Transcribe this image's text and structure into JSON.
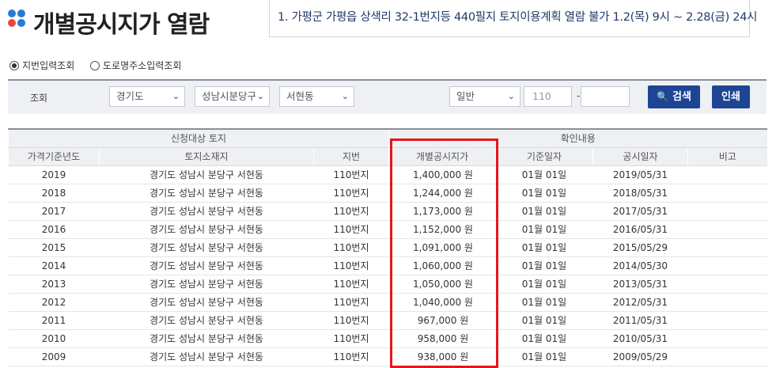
{
  "header": {
    "title": "개별공시지가 열람",
    "notice": "1. 가평군 가평읍 상색리 32-1번지등 440필지 토지이용계획 열람 불가 1.2(목) 9시 ~ 2.28(금) 24시"
  },
  "radio": {
    "option1": "지번입력조회",
    "option2": "도로명주소입력조회",
    "selected": "option1"
  },
  "search": {
    "label": "조회",
    "province": "경기도",
    "city": "성남시분당구",
    "dong": "서현동",
    "type": "일반",
    "lot_main": "110",
    "lot_sub": "",
    "search_button": "검색",
    "print_button": "인쇄"
  },
  "table": {
    "group1": "신청대상 토지",
    "group2": "확인내용",
    "columns": [
      "가격기준년도",
      "토지소재지",
      "지번",
      "개별공시지가",
      "기준일자",
      "공시일자",
      "비고"
    ],
    "rows": [
      [
        "2019",
        "경기도 성남시 분당구 서현동",
        "110번지",
        "1,400,000 원",
        "01월 01일",
        "2019/05/31",
        ""
      ],
      [
        "2018",
        "경기도 성남시 분당구 서현동",
        "110번지",
        "1,244,000 원",
        "01월 01일",
        "2018/05/31",
        ""
      ],
      [
        "2017",
        "경기도 성남시 분당구 서현동",
        "110번지",
        "1,173,000 원",
        "01월 01일",
        "2017/05/31",
        ""
      ],
      [
        "2016",
        "경기도 성남시 분당구 서현동",
        "110번지",
        "1,152,000 원",
        "01월 01일",
        "2016/05/31",
        ""
      ],
      [
        "2015",
        "경기도 성남시 분당구 서현동",
        "110번지",
        "1,091,000 원",
        "01월 01일",
        "2015/05/29",
        ""
      ],
      [
        "2014",
        "경기도 성남시 분당구 서현동",
        "110번지",
        "1,060,000 원",
        "01월 01일",
        "2014/05/30",
        ""
      ],
      [
        "2013",
        "경기도 성남시 분당구 서현동",
        "110번지",
        "1,050,000 원",
        "01월 01일",
        "2013/05/31",
        ""
      ],
      [
        "2012",
        "경기도 성남시 분당구 서현동",
        "110번지",
        "1,040,000 원",
        "01월 01일",
        "2012/05/31",
        ""
      ],
      [
        "2011",
        "경기도 성남시 분당구 서현동",
        "110번지",
        "967,000 원",
        "01월 01일",
        "2011/05/31",
        ""
      ],
      [
        "2010",
        "경기도 성남시 분당구 서현동",
        "110번지",
        "958,000 원",
        "01월 01일",
        "2010/05/31",
        ""
      ],
      [
        "2009",
        "경기도 성남시 분당구 서현동",
        "110번지",
        "938,000 원",
        "01월 01일",
        "2009/05/29",
        ""
      ]
    ]
  },
  "colors": {
    "accent": "#1e4594",
    "highlight": "#e3161b",
    "header_bg": "#eef0f3"
  },
  "icons": [
    "logo-dots-icon",
    "search-icon",
    "chevron-down-icon",
    "radio-icon"
  ]
}
